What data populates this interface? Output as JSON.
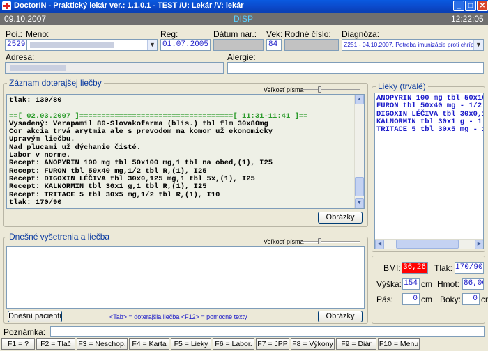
{
  "window": {
    "title": "DoctorIN - Praktický lekár ver.: 1.1.0.1 - TEST /U: Lekár /V: lekár",
    "minimize": "_",
    "maximize": "□",
    "close": "✕"
  },
  "infobar": {
    "date": "09.10.2007",
    "mode": "DISP",
    "time": "12:22:05"
  },
  "patient": {
    "poi_label": "Poi.:",
    "meno_label": "Meno:",
    "poi_value": "2529",
    "reg_label": "Reg:",
    "reg_value": "01.07.2005",
    "datum_label": "Dátum nar.:",
    "vek_label": "Vek:",
    "vek_value": "84",
    "rodne_label": "Rodné číslo:",
    "diag_label": "Diagnóza:",
    "diag_value": "Z251 - 04.10.2007, Potreba imunizácie proti chrípke",
    "adresa_label": "Adresa:",
    "alergie_label": "Alergie:"
  },
  "history": {
    "title": "Záznam doterajšej liečby",
    "font_label": "Veľkosť písma",
    "lines": [
      "tlak: 130/80",
      "",
      "==[ 02.03.2007 ]===================================[ 11:31-11:41 ]==",
      "Vysadený: Verapamil 80-Slovakofarma (blis.) tbl flm 30x80mg",
      "Cor akcia trvá arytmia ale s prevodom na komor už ekonomicky",
      "Upravým liečbu.",
      "Nad plucami už dýchanie čisté.",
      "Labor v norme.",
      "Recept: ANOPYRIN 100 mg tbl 50x100 mg,1 tbl na obed,(1), I25",
      "Recept: FURON tbl 50x40 mg,1/2 tbl R,(1), I25",
      "Recept: DIGOXIN LÉČIVA tbl 30x0,125 mg,1 tbl 5x,(1), I25",
      "Recept: KALNORMIN tbl 30x1 g,1 tbl R,(1), I25",
      "Recept: TRITACE 5 tbl 30x5 mg,1/2 tbl R,(1), I10",
      "tlak: 170/90"
    ],
    "images_button": "Obrázky"
  },
  "today": {
    "title": "Dnešné vyšetrenia a liečba",
    "font_label": "Veľkosť písma",
    "patients_button": "Dnešní pacienti",
    "hint": "<Tab> = doterajšia liečba   <F12> = pomocné texty",
    "images_button": "Obrázky"
  },
  "drugs": {
    "title": "Lieky (trvalé)",
    "items": [
      "ANOPYRIN 100 mg tbl 50x10",
      "FURON tbl 50x40 mg - 1/2",
      "DIGOXIN LÉČIVA tbl 30x0,1",
      "KALNORMIN tbl 30x1 g - 1",
      "TRITACE 5 tbl 30x5 mg - 1"
    ]
  },
  "vitals": {
    "bmi_label": "BMI:",
    "bmi_value": "36,26",
    "tlak_label": "Tlak:",
    "tlak_value": "170/90",
    "vyska_label": "Výška:",
    "vyska_value": "154",
    "cm": "cm",
    "hmot_label": "Hmot:",
    "hmot_value": "86,00",
    "pas_label": "Pás:",
    "pas_value": "0",
    "boky_label": "Boky:",
    "boky_value": "0"
  },
  "note": {
    "label": "Poznámka:"
  },
  "fkeys": [
    "F1 = ?",
    "F2 = Tlač",
    "F3 = Neschop.",
    "F4 = Karta",
    "F5 = Lieky",
    "F6 = Labor.",
    "F7 = JPP",
    "F8 = Výkony",
    "F9 = Diár",
    "F10 = Menu"
  ],
  "colors": {
    "bmi_bg": "#ff0000",
    "title_blue": "#0a3aa0",
    "drug_blue": "#1a1ac8",
    "history_green": "#2a9a2a"
  }
}
